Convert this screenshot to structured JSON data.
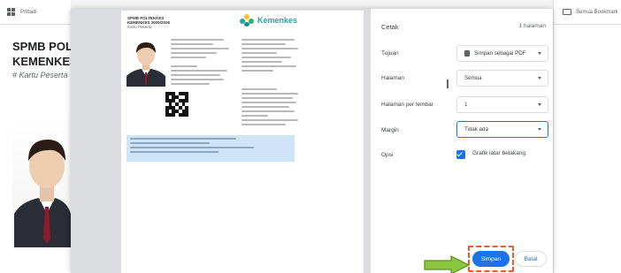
{
  "background_page": {
    "toolbar_label": "Pribadi",
    "title_line1": "SPMB POLTEKKES",
    "title_line2": "KEMENKES",
    "subtitle": "# Kartu Peserta",
    "right_toolbar_label": "Semua Bookmark"
  },
  "card": {
    "header_line1": "SPMB POLTEKKES",
    "header_line2": "KEMENKES 2025/2026",
    "header_line3": "Kartu Peserta",
    "brand": "Kemenkes"
  },
  "print_dialog": {
    "title": "Cetak",
    "page_count": "1 halaman",
    "rows": [
      {
        "label": "Tujuan",
        "value": "Simpan sebagai PDF",
        "icon": "printer-icon"
      },
      {
        "label": "Halaman",
        "value": "Semua"
      },
      {
        "label": "Halaman per lembar",
        "value": "1"
      },
      {
        "label": "Margin",
        "value": "Tidak ada"
      }
    ],
    "options_label": "Opsi",
    "options_checkbox_label": "Grafik latar belakang",
    "save_label": "Simpan",
    "cancel_label": "Batal"
  },
  "colors": {
    "accent": "#1a73e8",
    "highlight": "#f05a22",
    "arrow": "#8cc63f",
    "brand": "#23a6a6"
  }
}
